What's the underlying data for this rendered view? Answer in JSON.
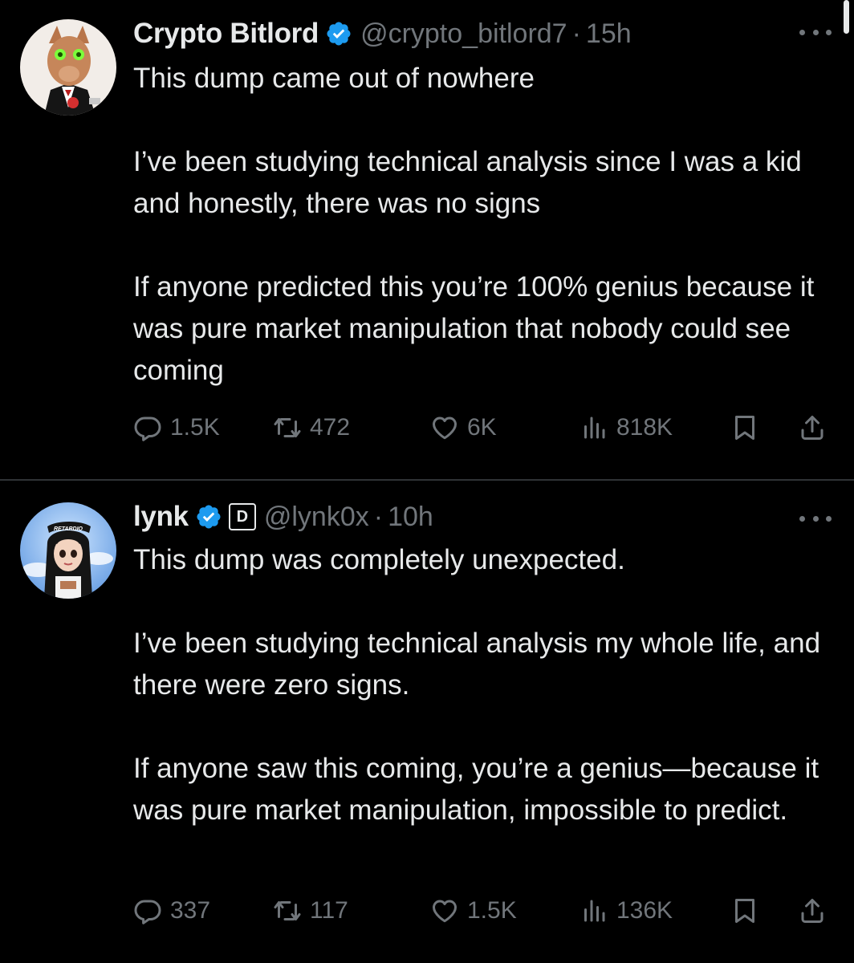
{
  "tweets": [
    {
      "name": "Crypto Bitlord",
      "handle": "@crypto_bitlord7",
      "separator": "·",
      "time": "15h",
      "paragraphs": [
        "This dump came out of nowhere",
        "I’ve been studying technical analysis since I was a kid and honestly, there was no signs",
        "If anyone predicted this you’re 100% genius because it was pure market manipulation that nobody could see coming"
      ],
      "stats": {
        "replies": "1.5K",
        "reposts": "472",
        "likes": "6K",
        "views": "818K"
      }
    },
    {
      "name": "lynk",
      "handle": "@lynk0x",
      "separator": "·",
      "time": "10h",
      "affiliate_badge": "D",
      "paragraphs": [
        "This dump was completely unexpected.",
        "I’ve been studying technical analysis my whole life, and there were zero signs.",
        "If anyone saw this coming, you’re a genius—because it was pure market manipulation, impossible to predict."
      ],
      "stats": {
        "replies": "337",
        "reposts": "117",
        "likes": "1.5K",
        "views": "136K"
      }
    }
  ],
  "icons": {
    "verified": "verified-badge-icon",
    "more": "more-dots-icon",
    "reply": "reply-icon",
    "repost": "repost-icon",
    "like": "heart-icon",
    "views": "views-bar-icon",
    "bookmark": "bookmark-icon",
    "share": "share-icon"
  },
  "colors": {
    "background": "#000000",
    "text": "#e7e9ea",
    "muted": "#71767b",
    "verified": "#1d9bf0",
    "divider": "#2f3336"
  }
}
